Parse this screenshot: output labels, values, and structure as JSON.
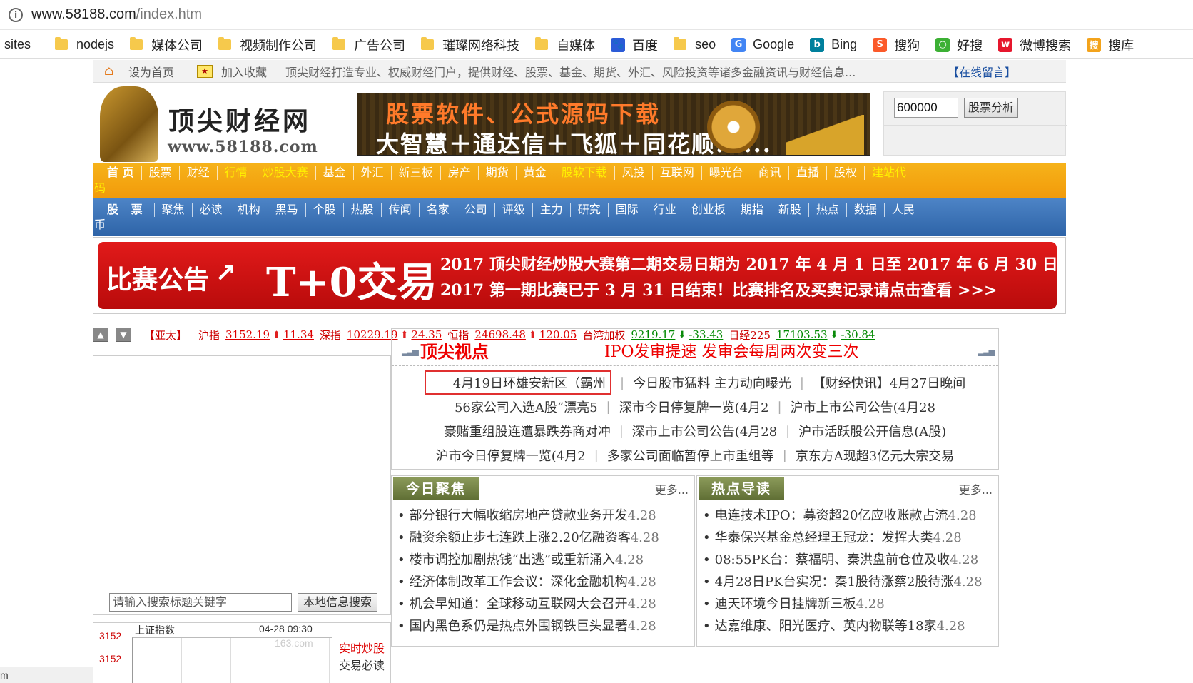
{
  "browser": {
    "url_host": "www.58188.com",
    "url_path": "/index.htm",
    "bookmarks": [
      {
        "label": "sites",
        "icon": "none"
      },
      {
        "label": "nodejs",
        "icon": "folder-icon"
      },
      {
        "label": "媒体公司",
        "icon": "folder-icon"
      },
      {
        "label": "视频制作公司",
        "icon": "folder-icon"
      },
      {
        "label": "广告公司",
        "icon": "folder-icon"
      },
      {
        "label": "璀璨网络科技",
        "icon": "folder-icon"
      },
      {
        "label": "自媒体",
        "icon": "folder-icon"
      },
      {
        "label": "百度",
        "icon": "baidu-icon"
      },
      {
        "label": "seo",
        "icon": "folder-icon"
      },
      {
        "label": "Google",
        "icon": "google-icon"
      },
      {
        "label": "Bing",
        "icon": "bing-icon"
      },
      {
        "label": "搜狗",
        "icon": "sogou-icon"
      },
      {
        "label": "好搜",
        "icon": "haosou-icon"
      },
      {
        "label": "微博搜索",
        "icon": "weibo-icon"
      },
      {
        "label": "搜库",
        "icon": "soku-icon"
      }
    ]
  },
  "topbar": {
    "set_home": "设为首页",
    "add_fav": "加入收藏",
    "intro": "顶尖财经打造专业、权威财经门户，提供财经、股票、基金、期货、外汇、风险投资等诸多金融资讯与财经信息...",
    "message": "【在线留言】"
  },
  "header": {
    "logo_title": "顶尖财经网",
    "logo_url": "www.58188.com",
    "banner_line1": "股票软件、公式源码下载",
    "banner_line2": "大智慧＋通达信＋飞狐＋同花顺......",
    "stock_code": "600000",
    "analyze_button": "股票分析"
  },
  "nav_main": {
    "items": [
      "首 页",
      "股票",
      "财经",
      "行情",
      "炒股大赛",
      "基金",
      "外汇",
      "新三板",
      "房产",
      "期货",
      "黄金",
      "股软下载",
      "风投",
      "互联网",
      "曝光台",
      "商讯",
      "直播",
      "股权",
      "建站代"
    ],
    "highlighted": [
      3,
      4,
      11,
      18
    ],
    "overflow": "码"
  },
  "nav_stock": {
    "items": [
      "股 票",
      "聚焦",
      "必读",
      "机构",
      "黑马",
      "个股",
      "热股",
      "传闻",
      "名家",
      "公司",
      "评级",
      "主力",
      "研究",
      "国际",
      "行业",
      "创业板",
      "期指",
      "新股",
      "热点",
      "数据",
      "人民"
    ],
    "overflow": "币"
  },
  "contest": {
    "label": "比赛公告",
    "arrow": "↗",
    "big": "T+0交易",
    "line1": "2017 顶尖财经炒股大赛第二期交易日期为 2017 年 4 月 1 日至 2017 年 6 月 30 日",
    "line2": "2017 第一期比赛已于 3 月 31 日结束！比赛排名及买卖记录请点击查看 >>>"
  },
  "ticker": {
    "region": "【亚太】",
    "indices": [
      {
        "name": "沪指",
        "value": "3152.19",
        "dir": "up",
        "change": "11.34"
      },
      {
        "name": "深指",
        "value": "10229.19",
        "dir": "up",
        "change": "24.35"
      },
      {
        "name": "恒指",
        "value": "24698.48",
        "dir": "up",
        "change": "120.05"
      },
      {
        "name": "台湾加权",
        "value": "9219.17",
        "dir": "down",
        "change": "-33.43"
      },
      {
        "name": "日经225",
        "value": "17103.53",
        "dir": "down",
        "change": "-30.84"
      }
    ]
  },
  "left": {
    "search_placeholder": "请输入搜索标题关键字",
    "search_button": "本地信息搜索",
    "index_name": "上证指数",
    "index_time": "04-28 09:30",
    "index_val1": "3152",
    "index_val2": "3152",
    "watermark": "163.com",
    "side1": "实时炒股",
    "side2": "交易必读"
  },
  "viewpoint": {
    "title": "顶尖视点",
    "headline": "IPO发审提速 发审会每周两次变三次",
    "rows": [
      [
        "4月19日环雄安新区（霸州",
        "今日股市猛料 主力动向曝光",
        "【财经快讯】4月27日晚间"
      ],
      [
        "56家公司入选A股“漂亮5",
        "深市今日停复牌一览(4月2",
        "沪市上市公司公告(4月28"
      ],
      [
        "豪赌重组股连遭暴跌券商对冲",
        "深市上市公司公告(4月28",
        "沪市活跃股公开信息(A股)"
      ],
      [
        "沪市今日停复牌一览(4月2",
        "多家公司面临暂停上市重组等",
        "京东方A现超3亿元大宗交易"
      ]
    ]
  },
  "focus": {
    "title": "今日聚焦",
    "more": "更多...",
    "items": [
      {
        "t": "部分银行大幅收缩房地产贷款业务开发",
        "d": "4.28"
      },
      {
        "t": "融资余额止步七连跌上涨2.20亿融资客",
        "d": "4.28"
      },
      {
        "t": "楼市调控加剧热钱“出逃”或重新涌入",
        "d": "4.28"
      },
      {
        "t": "经济体制改革工作会议：深化金融机构",
        "d": "4.28"
      },
      {
        "t": "机会早知道：全球移动互联网大会召开",
        "d": "4.28"
      },
      {
        "t": "国内黑色系仍是热点外围钢铁巨头显著",
        "d": "4.28"
      }
    ]
  },
  "hot": {
    "title": "热点导读",
    "more": "更多...",
    "items": [
      {
        "t": "电连技术IPO：募资超20亿应收账款占流",
        "d": "4.28"
      },
      {
        "t": "华泰保兴基金总经理王冠龙：发挥大类",
        "d": "4.28"
      },
      {
        "t": "08:55PK台：蔡福明、秦洪盘前仓位及收",
        "d": "4.28"
      },
      {
        "t": "4月28日PK台实况：秦1股待涨蔡2股待涨",
        "d": "4.28"
      },
      {
        "t": "迪天环境今日挂牌新三板",
        "d": "4.28"
      },
      {
        "t": "达嘉维康、阳光医疗、英内物联等18家",
        "d": "4.28"
      }
    ]
  },
  "status": "m"
}
